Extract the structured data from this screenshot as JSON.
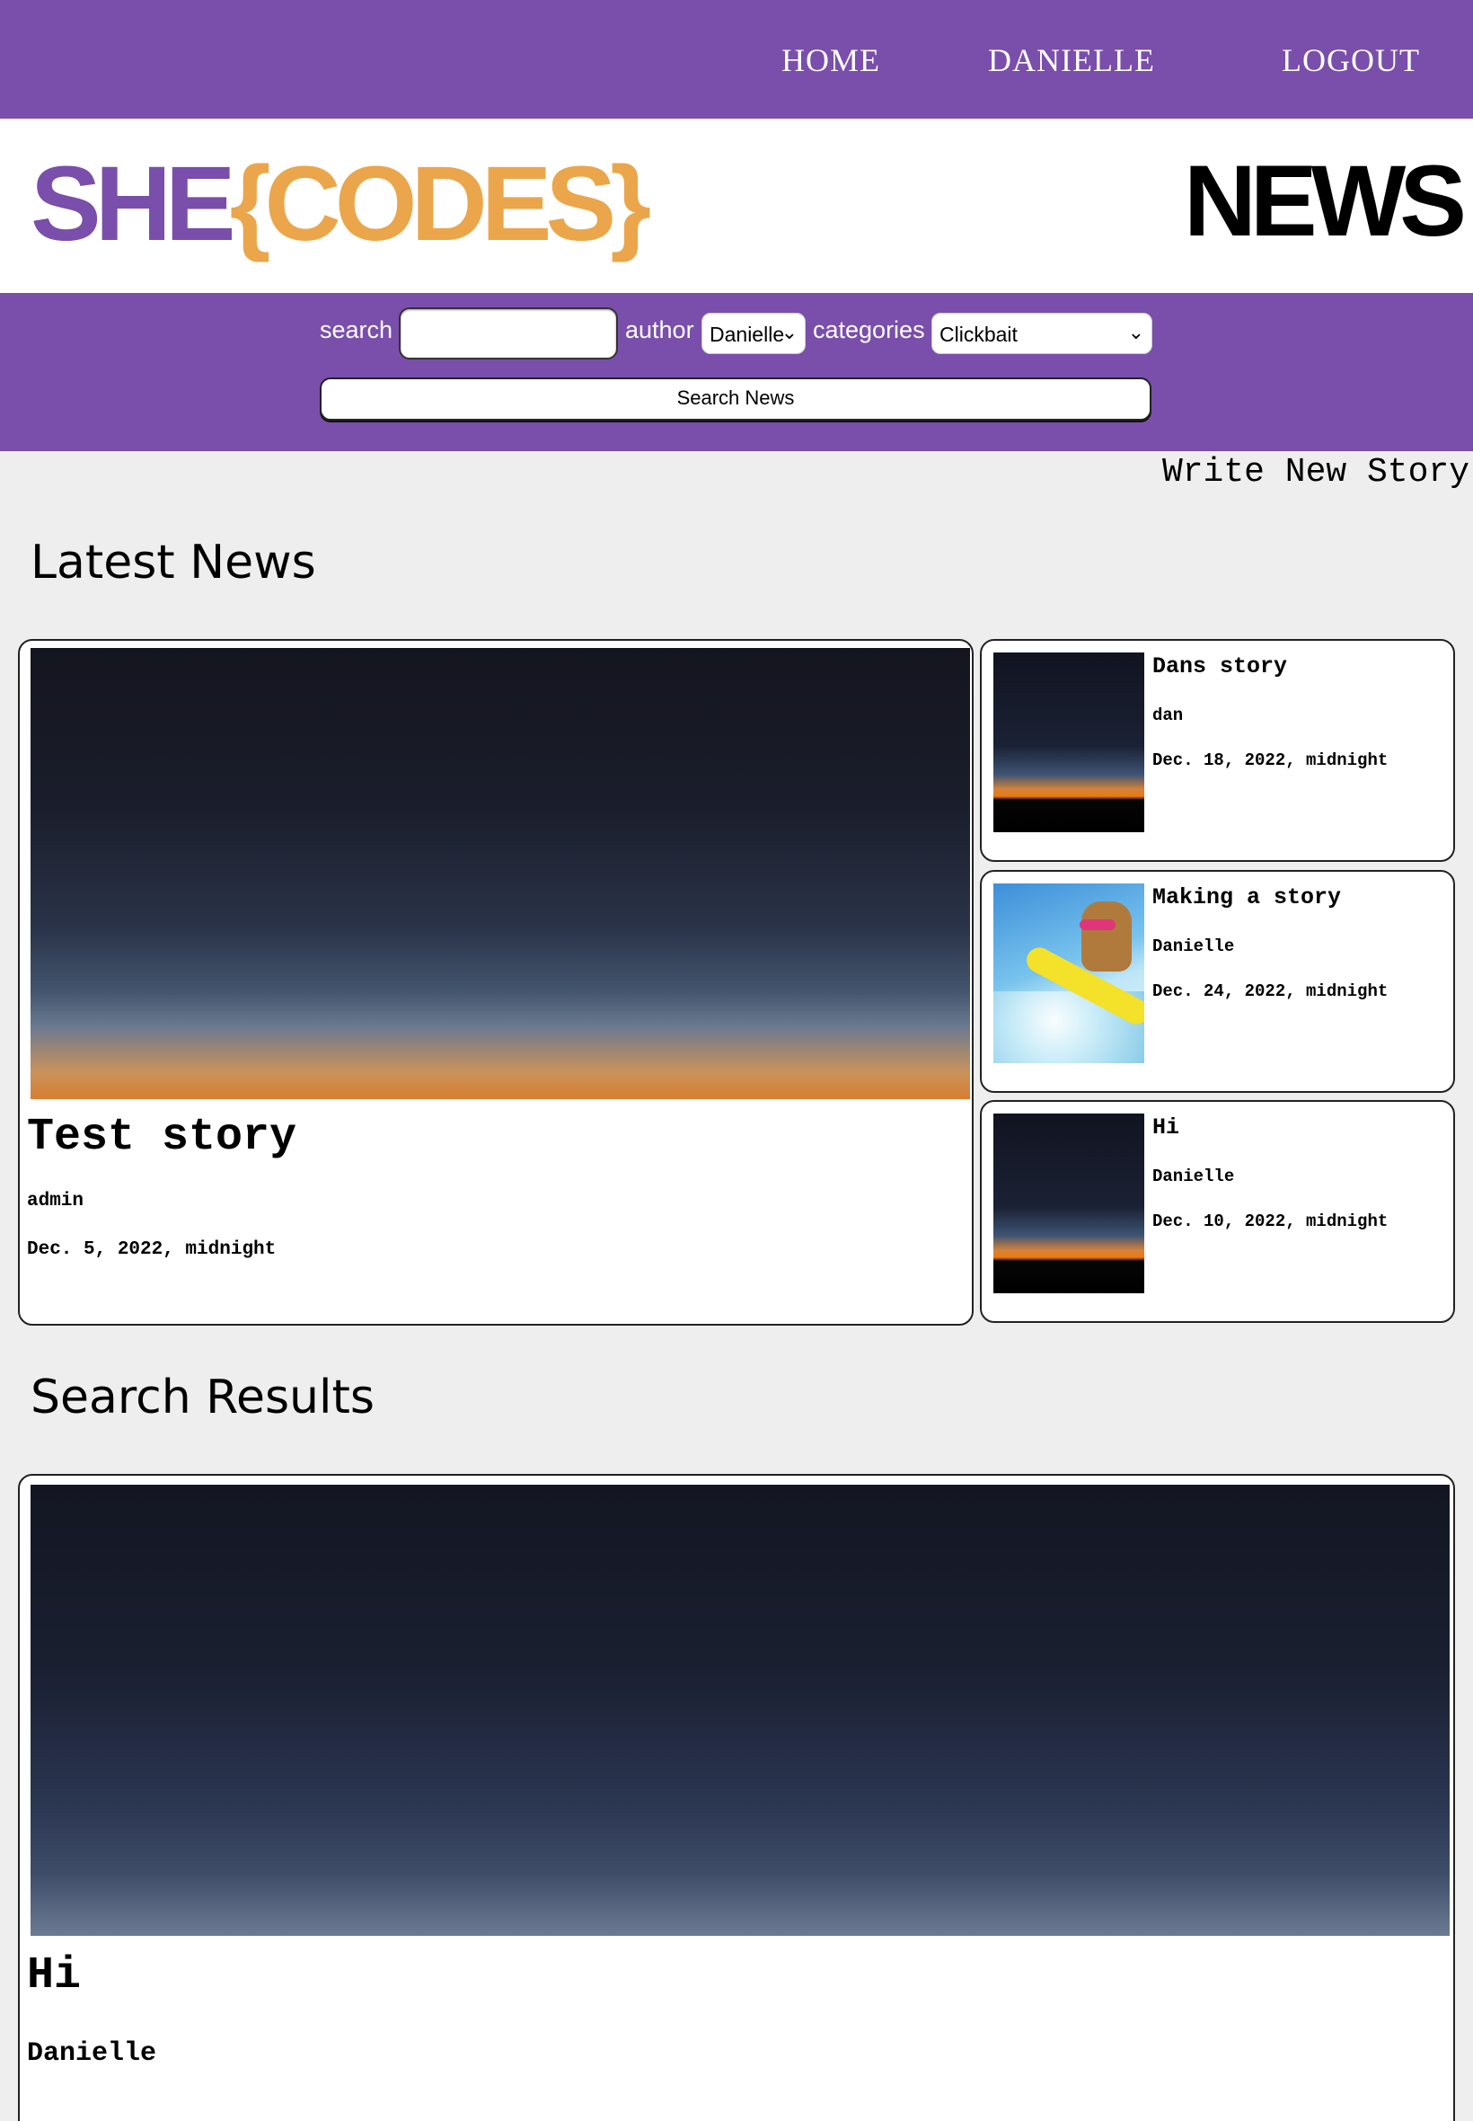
{
  "nav": {
    "home": "HOME",
    "user": "DANIELLE",
    "logout": "LOGOUT"
  },
  "brand": {
    "she": "SHE",
    "codes": "{CODES}",
    "news": "NEWS"
  },
  "search": {
    "search_label": "search",
    "search_value": "",
    "author_label": "author",
    "author_selected": "Danielle",
    "categories_label": "categories",
    "category_selected": "Clickbait",
    "button_label": "Search News"
  },
  "write_story": "Write New Story",
  "latest": {
    "heading": "Latest News",
    "featured": {
      "title": "Test story",
      "author": "admin",
      "date": "Dec. 5, 2022, midnight"
    },
    "side": [
      {
        "title": "Dans story",
        "author": "dan",
        "date": "Dec. 18, 2022, midnight"
      },
      {
        "title": "Making a story",
        "author": "Danielle",
        "date": "Dec. 24, 2022, midnight"
      },
      {
        "title": "Hi",
        "author": "Danielle",
        "date": "Dec. 10, 2022, midnight"
      }
    ]
  },
  "results": {
    "heading": "Search Results",
    "items": [
      {
        "title": "Hi",
        "author": "Danielle"
      }
    ]
  },
  "colors": {
    "purple": "#7a4eab",
    "orange": "#eba54a",
    "page_bg": "#eeeeee"
  },
  "icons": {
    "select_arrow": "chevron-down-icon"
  }
}
